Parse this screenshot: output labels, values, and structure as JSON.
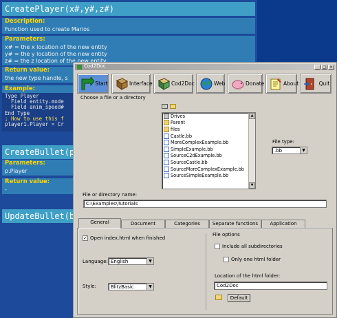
{
  "doc": {
    "func1_title": "CreatePlayer(x#,y#,z#)",
    "description_h": "Description:",
    "description": "Function used to create Marios",
    "parameters_h": "Parameters:",
    "params": [
      "x# = the x location of the new entity",
      "y# = the y location of the new entity",
      "z# = the z location of the new entity"
    ],
    "return_h": "Return value:",
    "return_val": "the new type handle, s",
    "example_h": "Example:",
    "example_code": [
      "Type Player",
      "  Field entity.mode",
      "  Field anim_speed#",
      "End Type",
      "; How to use this f",
      "player1.Player = Cr"
    ],
    "func2_title": "CreateBullet(p.Pl",
    "params2_h": "Parameters:",
    "params2": "p.Player",
    "return2_h": "Return value:",
    "return2": "-",
    "func3_title": "UpdateBullet(b.B"
  },
  "window": {
    "title": "Cod2Doc",
    "toolbar": [
      {
        "label": "Start",
        "icon": "start-arrow-icon"
      },
      {
        "label": "Interface",
        "icon": "book-icon"
      },
      {
        "label": "Cod2Doc",
        "icon": "cod2doc-book-icon"
      },
      {
        "label": "Web",
        "icon": "globe-icon"
      },
      {
        "label": "Donate",
        "icon": "piggy-bank-icon"
      },
      {
        "label": "About",
        "icon": "about-note-icon"
      },
      {
        "label": "Quit",
        "icon": "exit-door-icon"
      }
    ],
    "choose_label": "Choose a file or a directory",
    "file_list": [
      {
        "name": "Drives",
        "type": "drive"
      },
      {
        "name": "Parent",
        "type": "folder"
      },
      {
        "name": "files",
        "type": "folder"
      },
      {
        "name": "Castle.bb",
        "type": "file"
      },
      {
        "name": "MoreComplexExample.bb",
        "type": "file"
      },
      {
        "name": "SimpleExample.bb",
        "type": "file"
      },
      {
        "name": "SourceC2dExample.bb",
        "type": "file"
      },
      {
        "name": "SourceCastle.bb",
        "type": "file"
      },
      {
        "name": "SourceMoreComplexExample.bb",
        "type": "file"
      },
      {
        "name": "SourceSimpleExample.bb",
        "type": "file"
      }
    ],
    "file_type_label": "File type:",
    "file_type_value": ".bb",
    "path_label": "File or directory name:",
    "path_value": "C:\\Examples\\Tutorials",
    "tabs": [
      "General",
      "Document",
      "Categories",
      "Separate functions",
      "Application"
    ],
    "general": {
      "open_index": "Open index.html when finished",
      "open_index_checked": true,
      "language_label": "Language:",
      "language_value": "English",
      "style_label": "Style:",
      "style_value": "BlitzBasic",
      "file_options_label": "File options",
      "include_subdirs": "Include all subdirectories",
      "one_html_folder": "Only one html folder",
      "html_folder_label": "Location of the html folder:",
      "html_folder_value": "Cod2Doc",
      "default_button": "Default"
    }
  }
}
